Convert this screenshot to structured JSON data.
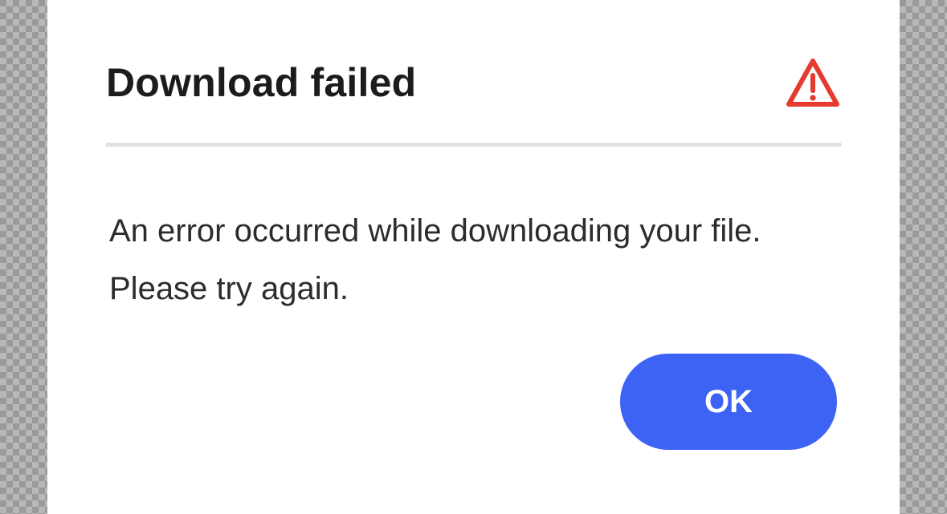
{
  "dialog": {
    "title": "Download failed",
    "icon": "warning-triangle-icon",
    "message": "An error occurred while downloading your file. Please try again.",
    "ok_label": "OK"
  },
  "colors": {
    "accent": "#3d63f5",
    "warning": "#e53a2d",
    "title_text": "#1c1c1c",
    "body_text": "#2c2c2c",
    "divider": "#e1e1e1"
  }
}
